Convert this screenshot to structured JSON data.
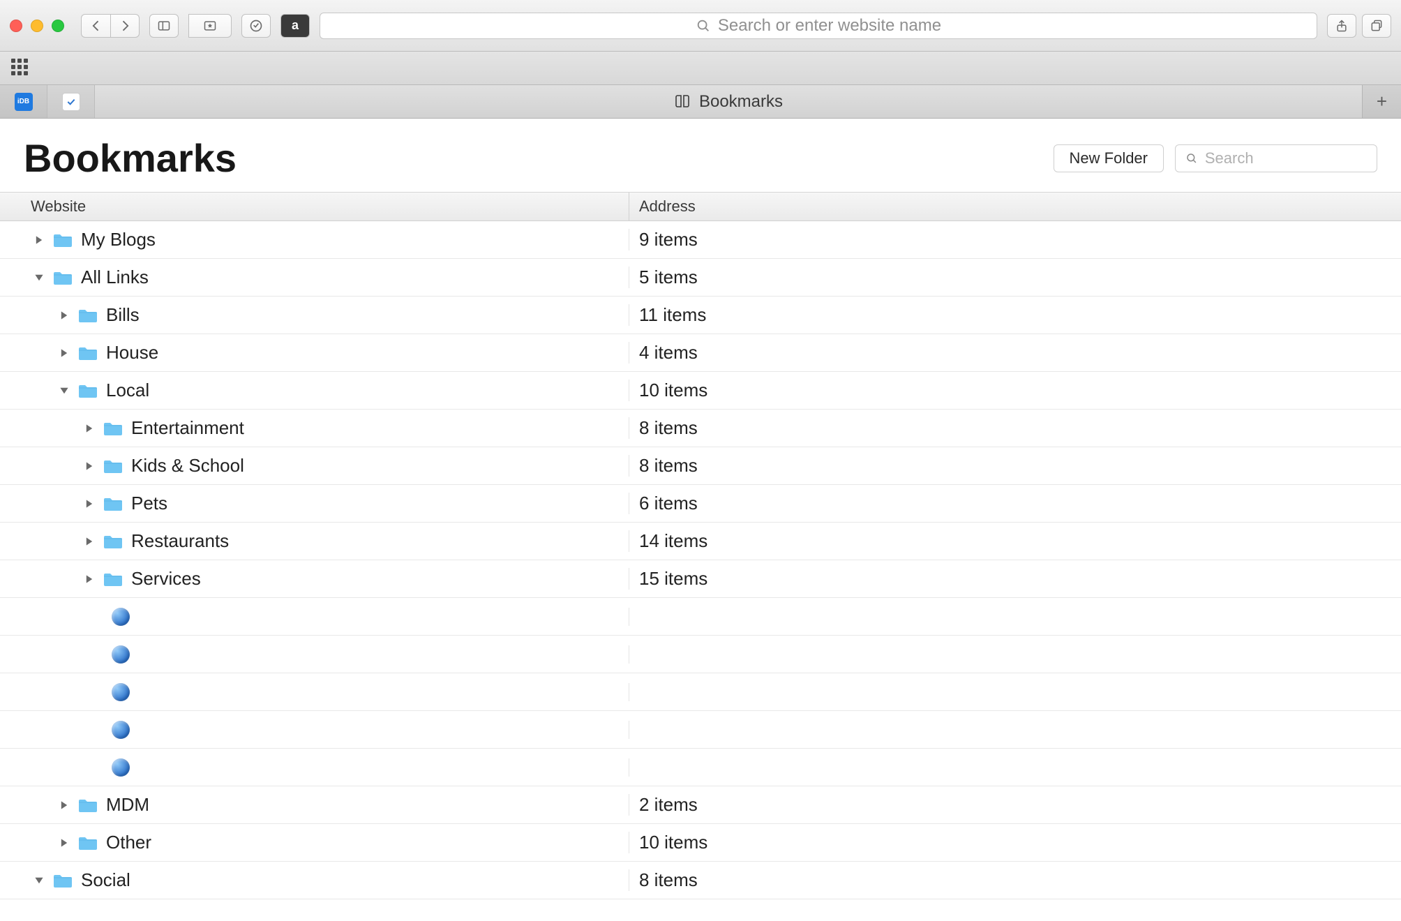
{
  "toolbar": {
    "address_placeholder": "Search or enter website name",
    "amazon_label": "a"
  },
  "tab": {
    "title": "Bookmarks",
    "pinned_label": "iDB"
  },
  "header": {
    "title": "Bookmarks",
    "new_folder_label": "New Folder",
    "search_placeholder": "Search"
  },
  "columns": {
    "website": "Website",
    "address": "Address"
  },
  "rows": [
    {
      "type": "folder",
      "level": 0,
      "expanded": false,
      "name": "My Blogs",
      "address": "9 items"
    },
    {
      "type": "folder",
      "level": 0,
      "expanded": true,
      "name": "All Links",
      "address": "5 items"
    },
    {
      "type": "folder",
      "level": 1,
      "expanded": false,
      "name": "Bills",
      "address": "11 items"
    },
    {
      "type": "folder",
      "level": 1,
      "expanded": false,
      "name": "House",
      "address": "4 items"
    },
    {
      "type": "folder",
      "level": 1,
      "expanded": true,
      "name": "Local",
      "address": "10 items"
    },
    {
      "type": "folder",
      "level": 2,
      "expanded": false,
      "name": "Entertainment",
      "address": "8 items"
    },
    {
      "type": "folder",
      "level": 2,
      "expanded": false,
      "name": "Kids & School",
      "address": "8 items"
    },
    {
      "type": "folder",
      "level": 2,
      "expanded": false,
      "name": "Pets",
      "address": "6 items"
    },
    {
      "type": "folder",
      "level": 2,
      "expanded": false,
      "name": "Restaurants",
      "address": "14 items"
    },
    {
      "type": "folder",
      "level": 2,
      "expanded": false,
      "name": "Services",
      "address": "15 items"
    },
    {
      "type": "bookmark",
      "level": 3,
      "name": "",
      "address": ""
    },
    {
      "type": "bookmark",
      "level": 3,
      "name": "",
      "address": ""
    },
    {
      "type": "bookmark",
      "level": 3,
      "name": "",
      "address": ""
    },
    {
      "type": "bookmark",
      "level": 3,
      "name": "",
      "address": ""
    },
    {
      "type": "bookmark",
      "level": 3,
      "name": "",
      "address": ""
    },
    {
      "type": "folder",
      "level": 1,
      "expanded": false,
      "name": "MDM",
      "address": "2 items"
    },
    {
      "type": "folder",
      "level": 1,
      "expanded": false,
      "name": "Other",
      "address": "10 items"
    },
    {
      "type": "folder",
      "level": 0,
      "expanded": true,
      "name": "Social",
      "address": "8 items"
    }
  ]
}
